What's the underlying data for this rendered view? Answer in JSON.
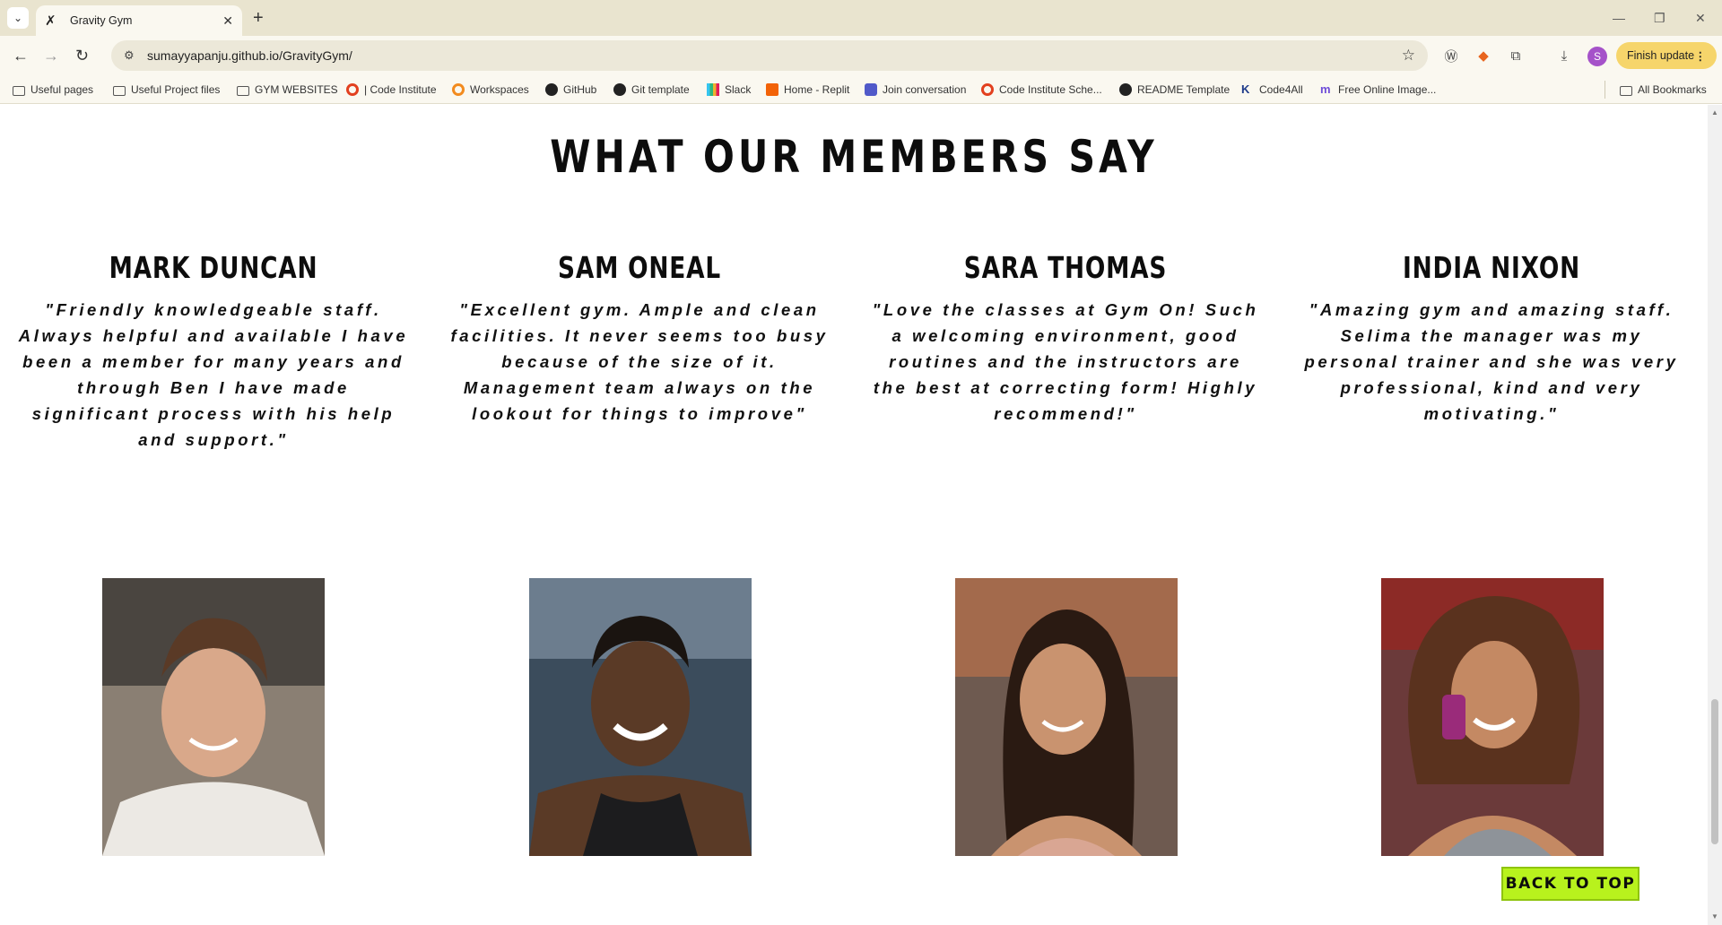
{
  "browser": {
    "tab_title": "Gravity Gym",
    "url": "sumayyapanju.github.io/GravityGym/",
    "finish_update_label": "Finish update",
    "avatar_initial": "S"
  },
  "bookmarks": [
    {
      "label": "Useful pages",
      "icon": "folder-icon"
    },
    {
      "label": "Useful Project files",
      "icon": "folder-icon"
    },
    {
      "label": "GYM WEBSITES",
      "icon": "folder-icon"
    },
    {
      "label": "| Code Institute",
      "icon": "code-institute-icon"
    },
    {
      "label": "Workspaces",
      "icon": "workspaces-icon"
    },
    {
      "label": "GitHub",
      "icon": "github-icon"
    },
    {
      "label": "Git template",
      "icon": "github-icon"
    },
    {
      "label": "Slack",
      "icon": "slack-icon"
    },
    {
      "label": "Home - Replit",
      "icon": "replit-icon"
    },
    {
      "label": "Join conversation",
      "icon": "teams-icon"
    },
    {
      "label": "Code Institute Sche...",
      "icon": "code-institute-icon"
    },
    {
      "label": "README Template",
      "icon": "github-icon"
    },
    {
      "label": "Code4All",
      "icon": "code4all-icon"
    },
    {
      "label": "Free Online Image...",
      "icon": "image-icon"
    }
  ],
  "all_bookmarks_label": "All Bookmarks",
  "page": {
    "section_title": "WHAT OUR MEMBERS SAY",
    "members": [
      {
        "name": "MARK DUNCAN",
        "quote": "\"Friendly knowledgeable staff. Always helpful and available I have been a member for many years and through Ben I have made significant process with his help and support.\""
      },
      {
        "name": "SAM ONEAL",
        "quote": "\"Excellent gym. Ample and clean facilities. It never seems too busy because of the size of it. Management team always on the lookout for things to improve\""
      },
      {
        "name": "SARA THOMAS",
        "quote": "\"Love the classes at Gym On! Such a welcoming environment, good routines and the instructors are the best at correcting form! Highly recommend!\""
      },
      {
        "name": "INDIA NIXON",
        "quote": "\"Amazing gym and amazing staff. Selima the manager was my personal trainer and she was very professional, kind and very motivating.\""
      }
    ],
    "back_to_top_label": "BACK TO TOP"
  },
  "colors": {
    "accent": "#b8f21d",
    "tabstrip": "#e9e4cf",
    "toolbar": "#faf8f0",
    "update_pill": "#f6d56b"
  }
}
